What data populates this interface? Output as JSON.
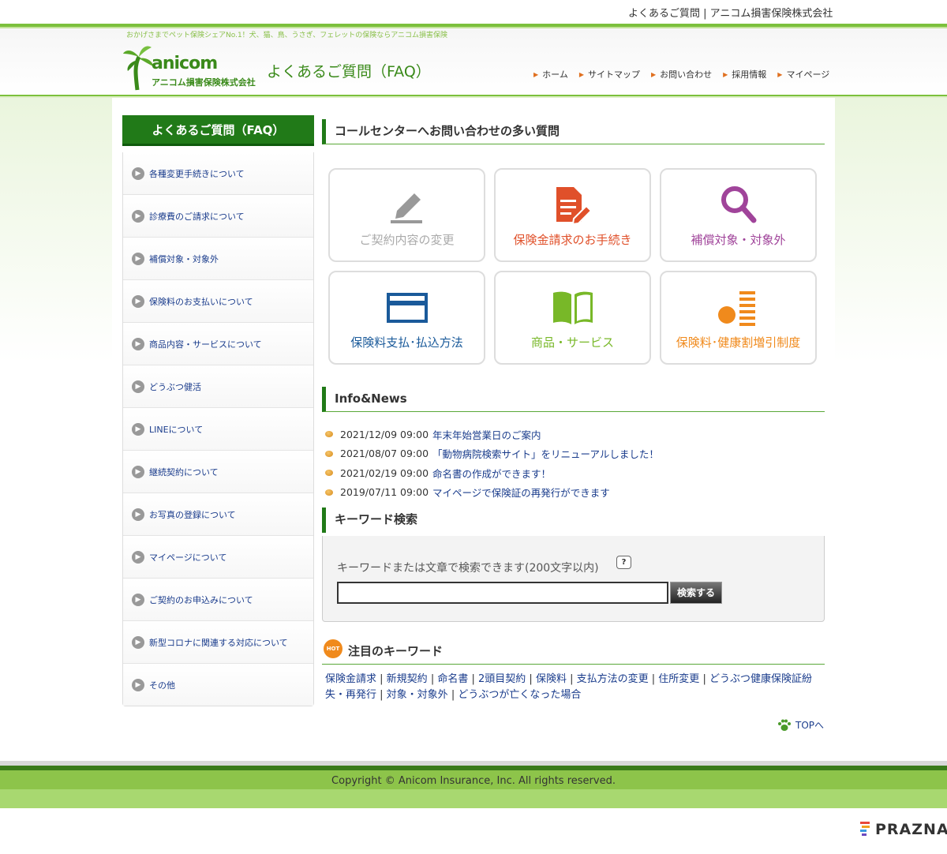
{
  "header": {
    "breadcrumb": "よくあるご質問 | アニコム損害保険株式会社",
    "tagline": "おかげさまでペット保険シェアNo.1！犬、猫、鳥、うさぎ、フェレットの保険ならアニコム損害保険",
    "logo_brand": "anicom",
    "logo_company": "アニコム損害保険株式会社",
    "site_title": "よくあるご質問（FAQ）",
    "nav": [
      "ホーム",
      "サイトマップ",
      "お問い合わせ",
      "採用情報",
      "マイページ"
    ]
  },
  "sidebar": {
    "heading": "よくあるご質問（FAQ）",
    "items": [
      "各種変更手続きについて",
      "診療費のご請求について",
      "補償対象・対象外",
      "保険料のお支払いについて",
      "商品内容・サービスについて",
      "どうぶつ健活",
      "LINEについて",
      "継続契約について",
      "お写真の登録について",
      "マイページについて",
      "ご契約のお申込みについて",
      "新型コロナに関連する対応について",
      "その他"
    ]
  },
  "callcenter": {
    "heading": "コールセンターへお問い合わせの多い質問",
    "tiles": [
      {
        "label": "ご契約内容の変更",
        "icon": "pencil-icon",
        "color": "#aaaaaa"
      },
      {
        "label": "保険金請求のお手続き",
        "icon": "document-edit-icon",
        "color": "#e0502a"
      },
      {
        "label": "補償対象・対象外",
        "icon": "magnifier-icon",
        "color": "#a0449a"
      },
      {
        "label": "保険料支払･払込方法",
        "icon": "credit-card-icon",
        "color": "#1a5a9a"
      },
      {
        "label": "商品・サービス",
        "icon": "book-icon",
        "color": "#78b828"
      },
      {
        "label": "保険料･健康割増引制度",
        "icon": "discount-chart-icon",
        "color": "#f08a1c"
      }
    ]
  },
  "news": {
    "heading": "Info&News",
    "items": [
      {
        "date": "2021/12/09 09:00",
        "title": "年末年始営業日のご案内"
      },
      {
        "date": "2021/08/07 09:00",
        "title": "「動物病院検索サイト」をリニューアルしました！"
      },
      {
        "date": "2021/02/19 09:00",
        "title": "命名書の作成ができます！"
      },
      {
        "date": "2019/07/11 09:00",
        "title": "マイページで保険証の再発行ができます"
      }
    ]
  },
  "search": {
    "heading": "キーワード検索",
    "hint": "キーワードまたは文章で検索できます(200文字以内)",
    "help": "?",
    "input_value": "",
    "button_label": "検索する"
  },
  "hot": {
    "badge": "HOT",
    "heading": "注目のキーワード",
    "keywords": [
      "保険金請求",
      "新規契約",
      "命名書",
      "2頭目契約",
      "保険料",
      "支払方法の変更",
      "住所変更",
      "どうぶつ健康保険証紛失・再発行",
      "対象・対象外",
      "どうぶつが亡くなった場合"
    ]
  },
  "toplink": "TOPへ",
  "footer": {
    "copyright": "Copyright © Anicom Insurance, Inc. All rights reserved.",
    "watermark": "PRAZNA"
  }
}
